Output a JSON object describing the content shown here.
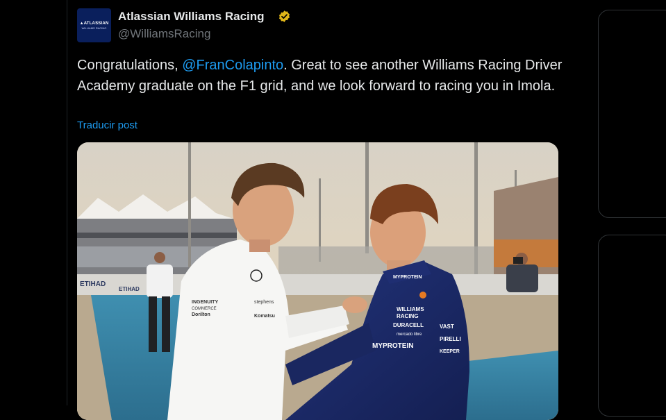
{
  "author": {
    "display_name": "Atlassian Williams Racing",
    "handle": "@WilliamsRacing",
    "avatar_logo_line1": "▲ATLASSIAN",
    "avatar_logo_line2": "WILLIAMS RACING",
    "verified": true,
    "verified_color": "#e2b719"
  },
  "tweet": {
    "text_before": "Congratulations, ",
    "mention": "@FranColapinto",
    "text_after": ". Great to see another Williams Racing Driver Academy graduate on the F1 grid, and we look forward to racing you in Imola.",
    "translate_label": "Traducir post"
  },
  "media": {
    "banner_text_1": "ETIHAD",
    "banner_text_2": "ETIHAD",
    "shirt_text_1": "INGENUITY",
    "shirt_text_2": "COMMERCE",
    "shirt_text_3": "stephens",
    "shirt_text_4": "Dorilton",
    "shirt_text_5": "Komatsu",
    "suit_text_1": "WILLIAMS",
    "suit_text_2": "RACING",
    "suit_text_3": "DURACELL",
    "suit_text_4": "mercado libre",
    "suit_text_5": "MYPROTEIN",
    "suit_text_6": "VAST",
    "suit_text_7": "PIRELLI",
    "suit_text_8": "KEEPER",
    "collar_text": "MYPROTEIN"
  },
  "colors": {
    "background": "#000000",
    "text": "#e7e9ea",
    "muted": "#71767b",
    "link": "#1d9bf0",
    "avatar_bg": "#0a1f5c"
  }
}
